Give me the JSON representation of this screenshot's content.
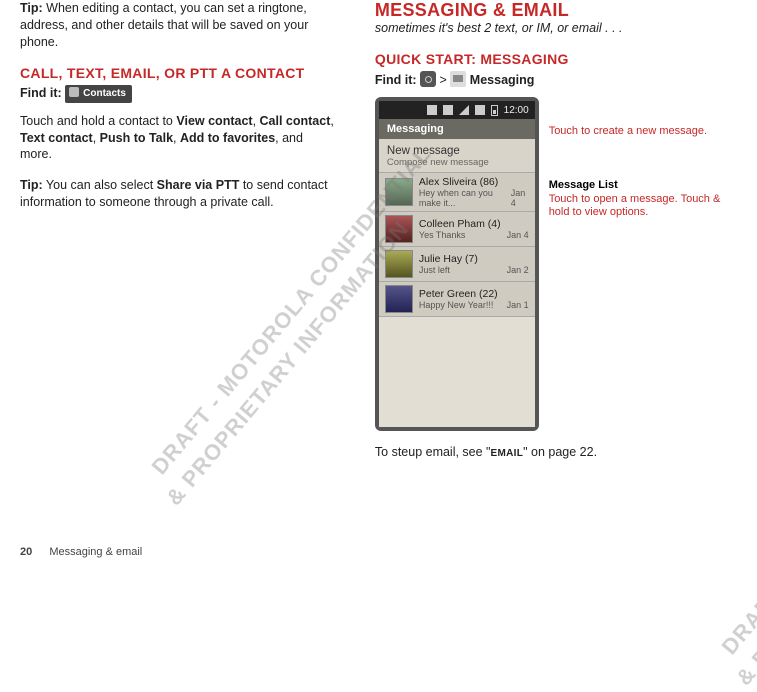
{
  "left": {
    "tip1_prefix": "Tip:",
    "tip1_body": " When editing a contact, you can set a ringtone, address, and other details that will be saved on your phone.",
    "heading2": "CALL, TEXT, EMAIL, OR PTT A CONTACT",
    "findit_label": "Find it:",
    "contacts_chip": "Contacts",
    "para1_a": "Touch and hold a contact to ",
    "para1_b": "View contact",
    "para1_c": ", ",
    "para1_d": "Call contact",
    "para1_e": ", ",
    "para1_f": "Text contact",
    "para1_g": ", ",
    "para1_h": "Push to Talk",
    "para1_i": ", ",
    "para1_j": "Add to favorites",
    "para1_k": ", and more.",
    "tip2_prefix": "Tip:",
    "tip2_a": " You can also select ",
    "tip2_b": "Share via PTT",
    "tip2_c": " to send contact information to someone through a private call."
  },
  "right": {
    "heading": "MESSAGING & EMAIL",
    "subtitle": "sometimes it's best 2 text, or IM, or email . . .",
    "quick": "QUICK START: MESSAGING",
    "findit_label": "Find it:",
    "gt": ">",
    "messaging_chip": "Messaging",
    "closing_a": "To steup email, see \"",
    "closing_b": "EMAIL",
    "closing_c": "\" on page 22."
  },
  "phone": {
    "time": "12:00",
    "titlebar": "Messaging",
    "new_title": "New message",
    "new_sub": "Compose new message",
    "rows": [
      {
        "name": "Alex Sliveira (86)",
        "preview": "Hey when can you make it...",
        "date": "Jan 4"
      },
      {
        "name": "Colleen Pham (4)",
        "preview": "Yes Thanks",
        "date": "Jan 4"
      },
      {
        "name": "Julie Hay (7)",
        "preview": "Just left",
        "date": "Jan 2"
      },
      {
        "name": "Peter Green (22)",
        "preview": "Happy New Year!!!",
        "date": "Jan 1"
      }
    ]
  },
  "annotations": {
    "a1": "Touch to create a new message.",
    "a2_title": "Message List",
    "a2_body": "Touch to open a message. Touch & hold to view options."
  },
  "watermark": {
    "line1": "DRAFT - MOTOROLA CONFIDENTIAL",
    "line2": "& PROPRIETARY INFORMATION"
  },
  "footer": {
    "page": "20",
    "section": "Messaging & email"
  }
}
